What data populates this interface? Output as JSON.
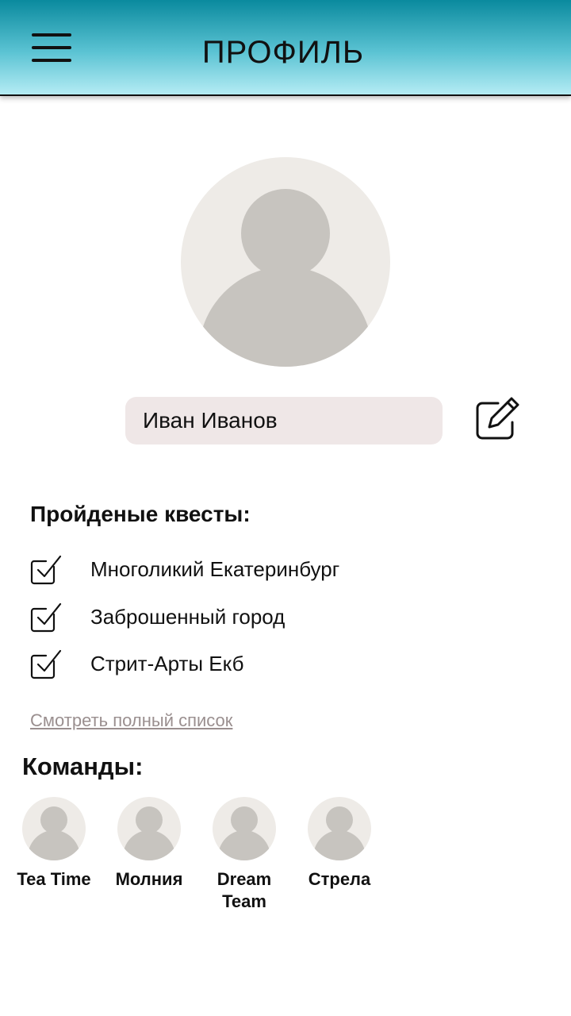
{
  "header": {
    "title": "ПРОФИЛЬ",
    "menu_icon": "hamburger-menu-icon",
    "gradient_colors": [
      "#0a8a9e",
      "#b5ecf4"
    ]
  },
  "profile": {
    "avatar_icon": "user-placeholder-icon",
    "name": "Иван Иванов",
    "edit_icon": "edit-pencil-icon"
  },
  "quests": {
    "title": "Пройденые квесты:",
    "items": [
      {
        "label": "Многоликий Екатеринбург",
        "checked": true
      },
      {
        "label": "Заброшенный город",
        "checked": true
      },
      {
        "label": "Стрит-Арты Екб",
        "checked": true
      }
    ],
    "view_all_label": "Смотреть полный список"
  },
  "teams": {
    "title": "Команды:",
    "items": [
      {
        "name": "Tea Time"
      },
      {
        "name": "Молния"
      },
      {
        "name": "Dream Team"
      },
      {
        "name": "Стрела"
      }
    ]
  },
  "colors": {
    "avatar_bg": "#eeebe7",
    "avatar_fg": "#c7c4bf",
    "name_field_bg": "#efe7e7",
    "link": "#9a8f8f"
  }
}
